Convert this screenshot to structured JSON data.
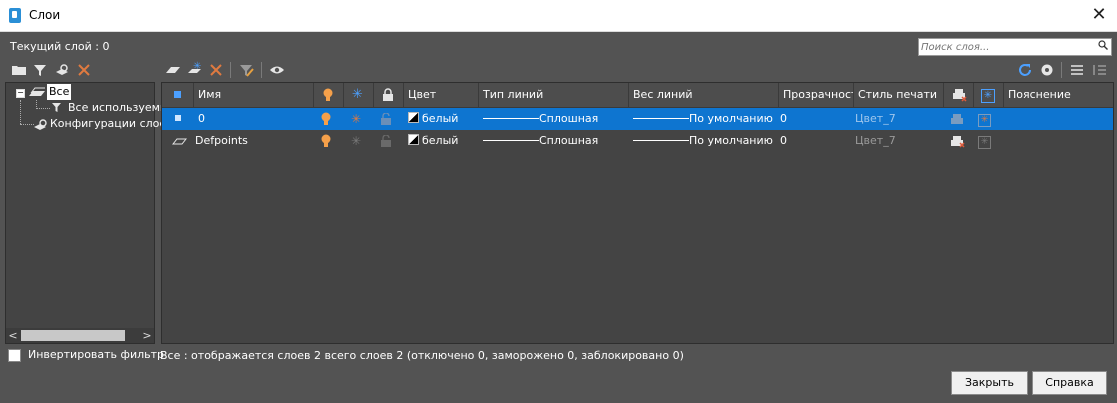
{
  "window": {
    "title": "Слои",
    "close_glyph": "✕"
  },
  "current_layer": "Текущий слой : 0",
  "search": {
    "placeholder": "Поиск слоя..."
  },
  "tree": {
    "all": "Все",
    "all_used": "Все используемые",
    "configs": "Конфигурации слоев"
  },
  "columns": {
    "name": "Имя",
    "color": "Цвет",
    "linetype": "Тип линий",
    "lineweight": "Вес линий",
    "transparency": "Прозрачность",
    "plotstyle": "Стиль печати",
    "description": "Пояснение"
  },
  "rows": [
    {
      "name": "0",
      "color": "белый",
      "linetype": "Сплошная",
      "lineweight": "По умолчанию",
      "transparency": "0",
      "plotstyle": "Цвет_7",
      "selected": true
    },
    {
      "name": "Defpoints",
      "color": "белый",
      "linetype": "Сплошная",
      "lineweight": "По умолчанию",
      "transparency": "0",
      "plotstyle": "Цвет_7",
      "selected": false
    }
  ],
  "invert_filter": "Инвертировать фильтр",
  "summary": "Все : отображается слоев 2 всего слоев 2 (отключено 0, заморожено 0, заблокировано 0)",
  "buttons": {
    "close": "Закрыть",
    "help": "Справка"
  },
  "colors": {
    "selected_row": "#0e75d0",
    "panel": "#535353",
    "grid_bg": "#444444",
    "bulb": "#f5a04a",
    "sun": "#4ca0ff",
    "freeze_orange": "#e07a40",
    "red_x": "#e05a3a"
  }
}
